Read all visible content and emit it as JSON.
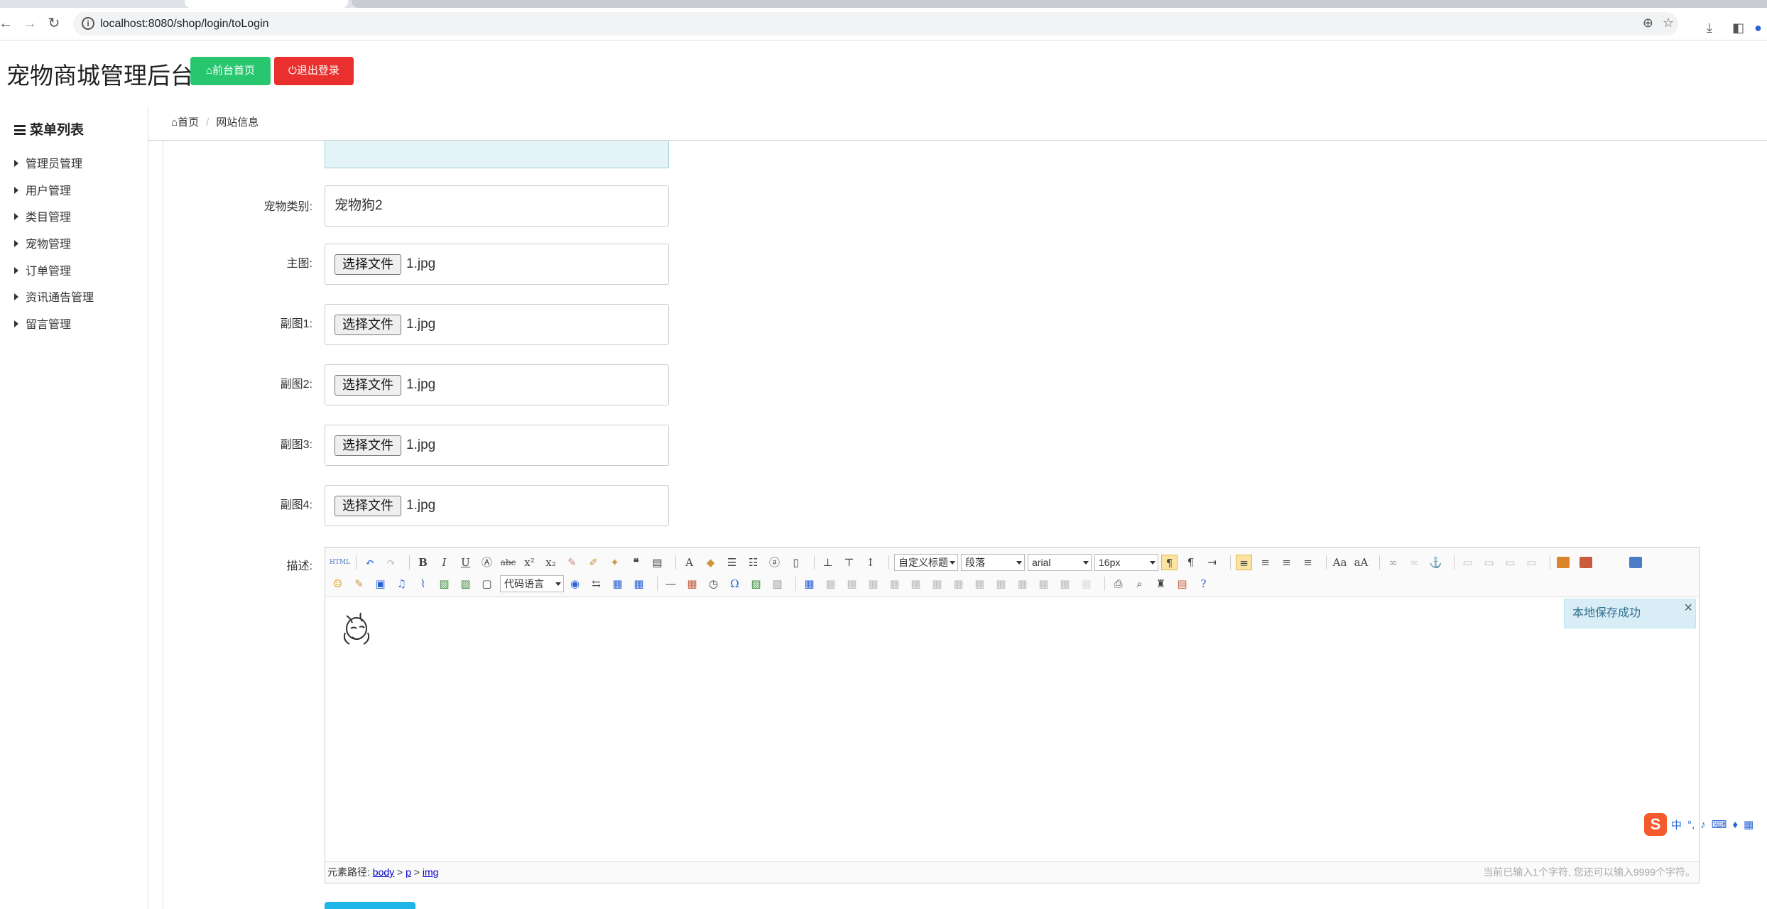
{
  "browser": {
    "url": "localhost:8080/shop/login/toLogin"
  },
  "header": {
    "title": "宠物商城管理后台",
    "front_button": "前台首页",
    "logout_button": "退出登录"
  },
  "sidebar": {
    "title": "菜单列表",
    "items": [
      {
        "label": "管理员管理"
      },
      {
        "label": "用户管理"
      },
      {
        "label": "类目管理"
      },
      {
        "label": "宠物管理"
      },
      {
        "label": "订单管理"
      },
      {
        "label": "资讯通告管理"
      },
      {
        "label": "留言管理"
      }
    ]
  },
  "breadcrumb": {
    "home": "首页",
    "current": "网站信息"
  },
  "form": {
    "category": {
      "label": "宠物类别:",
      "value": "宠物狗2"
    },
    "file_button": "选择文件",
    "main_image": {
      "label": "主图:",
      "file": "1.jpg"
    },
    "sub_image_1": {
      "label": "副图1:",
      "file": "1.jpg"
    },
    "sub_image_2": {
      "label": "副图2:",
      "file": "1.jpg"
    },
    "sub_image_3": {
      "label": "副图3:",
      "file": "1.jpg"
    },
    "sub_image_4": {
      "label": "副图4:",
      "file": "1.jpg"
    },
    "description": {
      "label": "描述:"
    }
  },
  "editor": {
    "heading_combo": "自定义标题",
    "paragraph_combo": "段落",
    "font_combo": "arial",
    "size_combo": "16px",
    "code_combo": "代码语言",
    "toast": "本地保存成功",
    "status_path_label": "元素路径:",
    "status_path": [
      "body",
      "p",
      "img"
    ],
    "status_count": "当前已输入1个字符, 您还可以输入9999个字符。"
  },
  "ime": {
    "logo": "S",
    "mode": "中"
  },
  "colors": {
    "green": "#28c76f",
    "red": "#ea2f2f",
    "toast_bg": "#d9edf7",
    "submit": "#1fb5e6"
  }
}
